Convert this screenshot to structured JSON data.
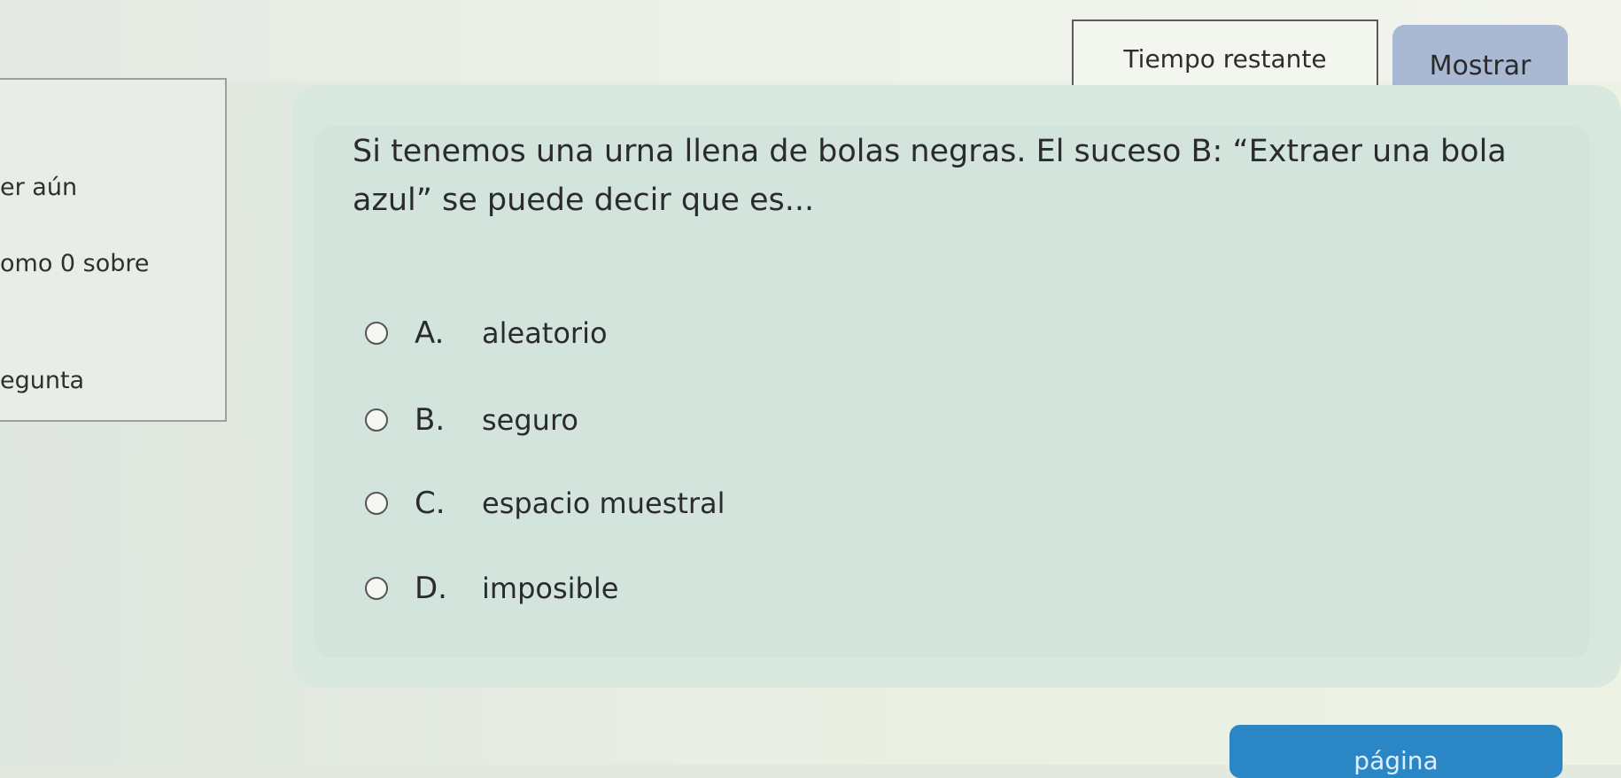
{
  "header": {
    "timer_label": "Tiempo restante",
    "show_button_label": "Mostrar"
  },
  "left_panel": {
    "line1": "er aún",
    "line2": "omo 0 sobre",
    "line3": "egunta"
  },
  "question": {
    "text": "Si tenemos una urna llena de bolas negras. El suceso B: “Extraer una bola azul” se puede decir que es...",
    "options": [
      {
        "letter": "A.",
        "text": "aleatorio"
      },
      {
        "letter": "B.",
        "text": "seguro"
      },
      {
        "letter": "C.",
        "text": "espacio muestral"
      },
      {
        "letter": "D.",
        "text": "imposible"
      }
    ]
  },
  "footer": {
    "next_button_label": "página"
  },
  "colors": {
    "card_background": "#d8e8df",
    "show_button": "#a9b9d4",
    "bottom_button": "#2a86c4"
  }
}
